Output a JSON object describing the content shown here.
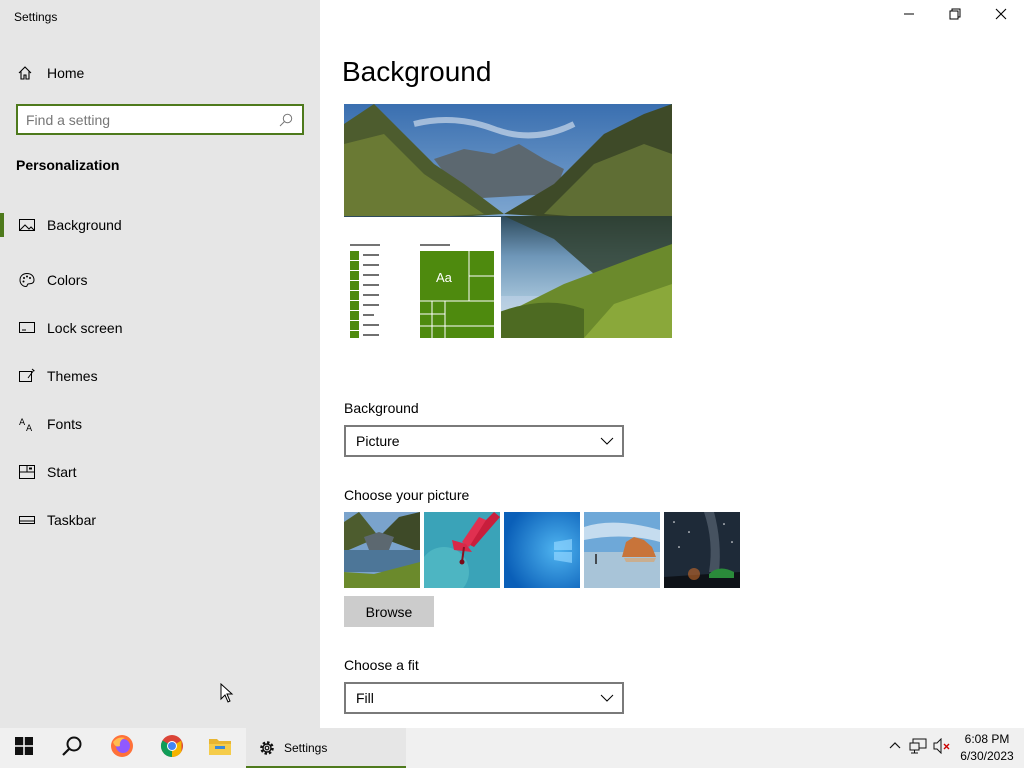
{
  "window": {
    "title": "Settings"
  },
  "sidebar": {
    "home_label": "Home",
    "search_placeholder": "Find a setting",
    "section_title": "Personalization",
    "items": [
      {
        "label": "Background",
        "icon": "picture-icon",
        "active": true
      },
      {
        "label": "Colors",
        "icon": "palette-icon"
      },
      {
        "label": "Lock screen",
        "icon": "lock-screen-icon"
      },
      {
        "label": "Themes",
        "icon": "themes-icon"
      },
      {
        "label": "Fonts",
        "icon": "fonts-icon"
      },
      {
        "label": "Start",
        "icon": "start-icon"
      },
      {
        "label": "Taskbar",
        "icon": "taskbar-icon"
      }
    ]
  },
  "main": {
    "title": "Background",
    "preview_tile_text": "Aa",
    "background_label": "Background",
    "background_value": "Picture",
    "choose_picture_label": "Choose your picture",
    "browse_label": "Browse",
    "choose_fit_label": "Choose a fit",
    "fit_value": "Fill"
  },
  "taskbar": {
    "settings_label": "Settings",
    "time": "6:08 PM",
    "date": "6/30/2023"
  },
  "colors": {
    "accent": "#4e7a1c",
    "tile_green": "#4e8a0e",
    "sidebar_bg": "#e6e6e6",
    "taskbar_bg": "#f0f0f0"
  }
}
